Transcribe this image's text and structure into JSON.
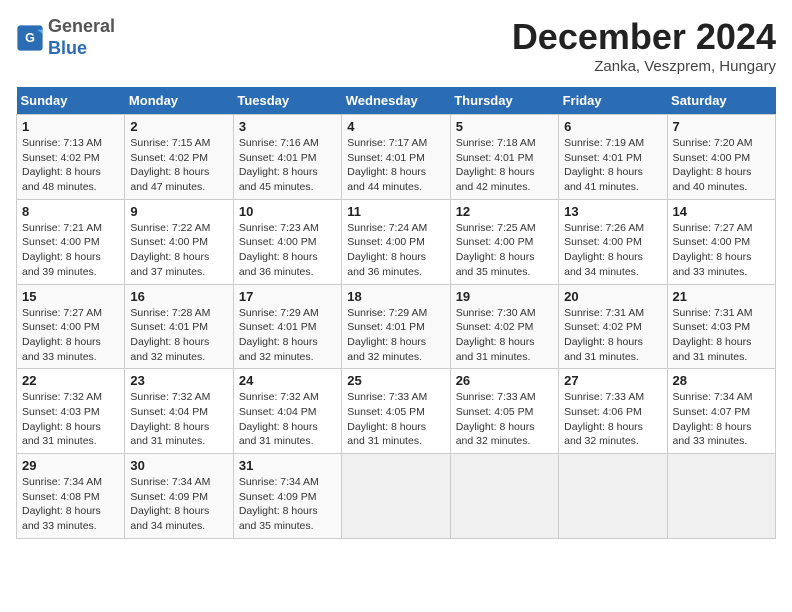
{
  "header": {
    "logo_general": "General",
    "logo_blue": "Blue",
    "month_title": "December 2024",
    "subtitle": "Zanka, Veszprem, Hungary"
  },
  "weekdays": [
    "Sunday",
    "Monday",
    "Tuesday",
    "Wednesday",
    "Thursday",
    "Friday",
    "Saturday"
  ],
  "weeks": [
    [
      {
        "day": "1",
        "sunrise": "Sunrise: 7:13 AM",
        "sunset": "Sunset: 4:02 PM",
        "daylight": "Daylight: 8 hours and 48 minutes."
      },
      {
        "day": "2",
        "sunrise": "Sunrise: 7:15 AM",
        "sunset": "Sunset: 4:02 PM",
        "daylight": "Daylight: 8 hours and 47 minutes."
      },
      {
        "day": "3",
        "sunrise": "Sunrise: 7:16 AM",
        "sunset": "Sunset: 4:01 PM",
        "daylight": "Daylight: 8 hours and 45 minutes."
      },
      {
        "day": "4",
        "sunrise": "Sunrise: 7:17 AM",
        "sunset": "Sunset: 4:01 PM",
        "daylight": "Daylight: 8 hours and 44 minutes."
      },
      {
        "day": "5",
        "sunrise": "Sunrise: 7:18 AM",
        "sunset": "Sunset: 4:01 PM",
        "daylight": "Daylight: 8 hours and 42 minutes."
      },
      {
        "day": "6",
        "sunrise": "Sunrise: 7:19 AM",
        "sunset": "Sunset: 4:01 PM",
        "daylight": "Daylight: 8 hours and 41 minutes."
      },
      {
        "day": "7",
        "sunrise": "Sunrise: 7:20 AM",
        "sunset": "Sunset: 4:00 PM",
        "daylight": "Daylight: 8 hours and 40 minutes."
      }
    ],
    [
      {
        "day": "8",
        "sunrise": "Sunrise: 7:21 AM",
        "sunset": "Sunset: 4:00 PM",
        "daylight": "Daylight: 8 hours and 39 minutes."
      },
      {
        "day": "9",
        "sunrise": "Sunrise: 7:22 AM",
        "sunset": "Sunset: 4:00 PM",
        "daylight": "Daylight: 8 hours and 37 minutes."
      },
      {
        "day": "10",
        "sunrise": "Sunrise: 7:23 AM",
        "sunset": "Sunset: 4:00 PM",
        "daylight": "Daylight: 8 hours and 36 minutes."
      },
      {
        "day": "11",
        "sunrise": "Sunrise: 7:24 AM",
        "sunset": "Sunset: 4:00 PM",
        "daylight": "Daylight: 8 hours and 36 minutes."
      },
      {
        "day": "12",
        "sunrise": "Sunrise: 7:25 AM",
        "sunset": "Sunset: 4:00 PM",
        "daylight": "Daylight: 8 hours and 35 minutes."
      },
      {
        "day": "13",
        "sunrise": "Sunrise: 7:26 AM",
        "sunset": "Sunset: 4:00 PM",
        "daylight": "Daylight: 8 hours and 34 minutes."
      },
      {
        "day": "14",
        "sunrise": "Sunrise: 7:27 AM",
        "sunset": "Sunset: 4:00 PM",
        "daylight": "Daylight: 8 hours and 33 minutes."
      }
    ],
    [
      {
        "day": "15",
        "sunrise": "Sunrise: 7:27 AM",
        "sunset": "Sunset: 4:00 PM",
        "daylight": "Daylight: 8 hours and 33 minutes."
      },
      {
        "day": "16",
        "sunrise": "Sunrise: 7:28 AM",
        "sunset": "Sunset: 4:01 PM",
        "daylight": "Daylight: 8 hours and 32 minutes."
      },
      {
        "day": "17",
        "sunrise": "Sunrise: 7:29 AM",
        "sunset": "Sunset: 4:01 PM",
        "daylight": "Daylight: 8 hours and 32 minutes."
      },
      {
        "day": "18",
        "sunrise": "Sunrise: 7:29 AM",
        "sunset": "Sunset: 4:01 PM",
        "daylight": "Daylight: 8 hours and 32 minutes."
      },
      {
        "day": "19",
        "sunrise": "Sunrise: 7:30 AM",
        "sunset": "Sunset: 4:02 PM",
        "daylight": "Daylight: 8 hours and 31 minutes."
      },
      {
        "day": "20",
        "sunrise": "Sunrise: 7:31 AM",
        "sunset": "Sunset: 4:02 PM",
        "daylight": "Daylight: 8 hours and 31 minutes."
      },
      {
        "day": "21",
        "sunrise": "Sunrise: 7:31 AM",
        "sunset": "Sunset: 4:03 PM",
        "daylight": "Daylight: 8 hours and 31 minutes."
      }
    ],
    [
      {
        "day": "22",
        "sunrise": "Sunrise: 7:32 AM",
        "sunset": "Sunset: 4:03 PM",
        "daylight": "Daylight: 8 hours and 31 minutes."
      },
      {
        "day": "23",
        "sunrise": "Sunrise: 7:32 AM",
        "sunset": "Sunset: 4:04 PM",
        "daylight": "Daylight: 8 hours and 31 minutes."
      },
      {
        "day": "24",
        "sunrise": "Sunrise: 7:32 AM",
        "sunset": "Sunset: 4:04 PM",
        "daylight": "Daylight: 8 hours and 31 minutes."
      },
      {
        "day": "25",
        "sunrise": "Sunrise: 7:33 AM",
        "sunset": "Sunset: 4:05 PM",
        "daylight": "Daylight: 8 hours and 31 minutes."
      },
      {
        "day": "26",
        "sunrise": "Sunrise: 7:33 AM",
        "sunset": "Sunset: 4:05 PM",
        "daylight": "Daylight: 8 hours and 32 minutes."
      },
      {
        "day": "27",
        "sunrise": "Sunrise: 7:33 AM",
        "sunset": "Sunset: 4:06 PM",
        "daylight": "Daylight: 8 hours and 32 minutes."
      },
      {
        "day": "28",
        "sunrise": "Sunrise: 7:34 AM",
        "sunset": "Sunset: 4:07 PM",
        "daylight": "Daylight: 8 hours and 33 minutes."
      }
    ],
    [
      {
        "day": "29",
        "sunrise": "Sunrise: 7:34 AM",
        "sunset": "Sunset: 4:08 PM",
        "daylight": "Daylight: 8 hours and 33 minutes."
      },
      {
        "day": "30",
        "sunrise": "Sunrise: 7:34 AM",
        "sunset": "Sunset: 4:09 PM",
        "daylight": "Daylight: 8 hours and 34 minutes."
      },
      {
        "day": "31",
        "sunrise": "Sunrise: 7:34 AM",
        "sunset": "Sunset: 4:09 PM",
        "daylight": "Daylight: 8 hours and 35 minutes."
      },
      null,
      null,
      null,
      null
    ]
  ]
}
